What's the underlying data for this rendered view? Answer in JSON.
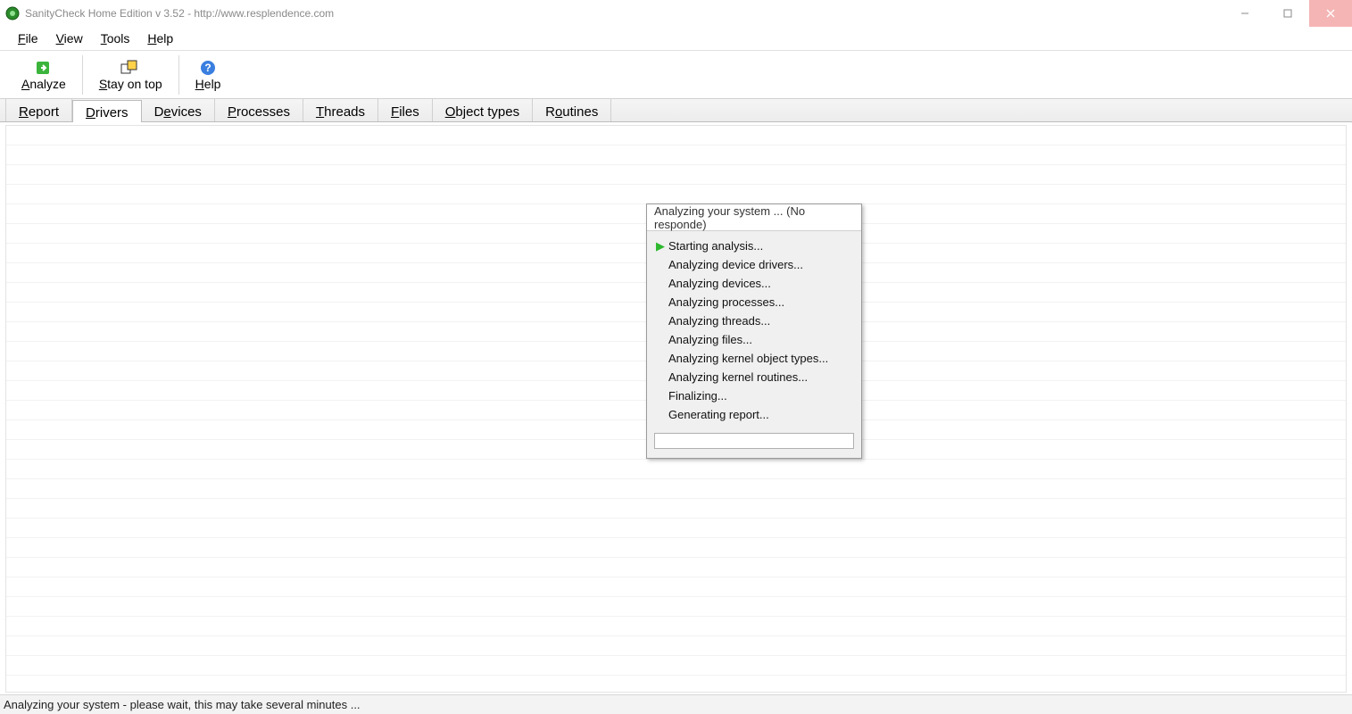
{
  "window": {
    "title": "SanityCheck Home Edition  v 3.52    -    http://www.resplendence.com"
  },
  "menu": {
    "file": "File",
    "view": "View",
    "tools": "Tools",
    "help": "Help"
  },
  "toolbar": {
    "analyze": "Analyze",
    "stayontop": "Stay on top",
    "help": "Help"
  },
  "tabs": {
    "report": "Report",
    "drivers": "Drivers",
    "devices": "Devices",
    "processes": "Processes",
    "threads": "Threads",
    "files": "Files",
    "objecttypes": "Object types",
    "routines": "Routines"
  },
  "dialog": {
    "title": "Analyzing your system ... (No responde)",
    "steps": [
      "Starting analysis...",
      "Analyzing device drivers...",
      "Analyzing devices...",
      "Analyzing processes...",
      "Analyzing threads...",
      "Analyzing files...",
      "Analyzing kernel object types...",
      "Analyzing kernel routines...",
      "Finalizing...",
      "Generating report..."
    ],
    "active_step": 0
  },
  "statusbar": {
    "text": "Analyzing your system - please wait, this may take several minutes ..."
  }
}
